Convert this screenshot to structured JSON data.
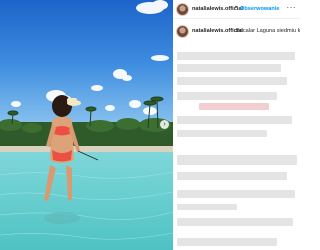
{
  "post": {
    "username": "natalialewis.official",
    "follow_label": "Obserwowanie",
    "separator": "•",
    "more_icon": "more-options-icon",
    "caption_username": "natalialewis.official",
    "caption_text": "Bacalar Laguna siedmiu kolorów"
  },
  "photo": {
    "description_icon": "beach-photo",
    "nav_icon": "chevron-right-icon"
  },
  "colors": {
    "link_blue": "#0095f6",
    "text": "#262626",
    "redacted_gray": "#e4e4e4",
    "redacted_pink": "#f2cfd0"
  }
}
